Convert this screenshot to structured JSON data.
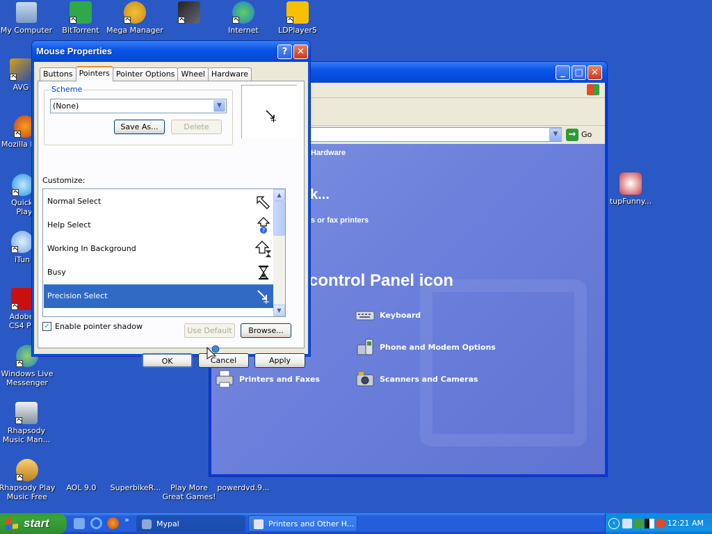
{
  "desktop": {
    "icons": [
      {
        "label": "My Computer"
      },
      {
        "label": "BitTorrent"
      },
      {
        "label": "Mega Manager"
      },
      {
        "label": "Internet Downlo"
      },
      {
        "label": "LDPlayer5"
      },
      {
        "label": "AVG"
      },
      {
        "label": "Mozilla F"
      },
      {
        "label": "QuickT Play"
      },
      {
        "label": "iTun"
      },
      {
        "label": "Adobe CS4 Pr"
      },
      {
        "label": "Windows Live Messenger"
      },
      {
        "label": "Rhapsody Music Man..."
      },
      {
        "label": "Rhapsody Play Music Free"
      },
      {
        "label": "AOL 9.0"
      },
      {
        "label": "SuperbikeR..."
      },
      {
        "label": "Play More Great Games!"
      },
      {
        "label": "powerdvd.9..."
      },
      {
        "label": "tupFunny..."
      }
    ]
  },
  "explorer": {
    "go_label": "Go",
    "category_fragment": "Hardware",
    "task_fragment": "k...",
    "printers_fragment": "s or fax printers",
    "cp_icon_heading": "control Panel icon",
    "items": [
      {
        "label": "Keyboard"
      },
      {
        "label": "Phone and Modem Options"
      },
      {
        "label": "Printers and Faxes"
      },
      {
        "label": "Scanners and Cameras"
      }
    ]
  },
  "dialog": {
    "title": "Mouse Properties",
    "help_label": "?",
    "tabs": [
      {
        "label": "Buttons"
      },
      {
        "label": "Pointers"
      },
      {
        "label": "Pointer Options"
      },
      {
        "label": "Wheel"
      },
      {
        "label": "Hardware"
      }
    ],
    "active_tab": "Pointers",
    "scheme_label": "Scheme",
    "scheme_value": "(None)",
    "save_as_label": "Save As...",
    "delete_label": "Delete",
    "customize_label": "Customize:",
    "pointers": [
      {
        "label": "Normal Select",
        "icon": "arrow-cursor-icon"
      },
      {
        "label": "Help Select",
        "icon": "help-cursor-icon"
      },
      {
        "label": "Working In Background",
        "icon": "working-cursor-icon"
      },
      {
        "label": "Busy",
        "icon": "hourglass-cursor-icon"
      },
      {
        "label": "Precision Select",
        "icon": "precision-cursor-icon"
      }
    ],
    "selected_pointer": "Precision Select",
    "shadow_label": "Enable pointer shadow",
    "shadow_checked": true,
    "use_default_label": "Use Default",
    "browse_label": "Browse...",
    "ok_label": "OK",
    "cancel_label": "Cancel",
    "apply_label": "Apply"
  },
  "taskbar": {
    "start_label": "start",
    "items": [
      {
        "label": "Mypal"
      },
      {
        "label": "Printers and Other H..."
      }
    ],
    "clock": "12:21 AM"
  },
  "colors": {
    "desktop": "#2a58c5",
    "titlebar": "#0a55e8",
    "selection": "#316ac5",
    "start_green": "#38a238"
  }
}
